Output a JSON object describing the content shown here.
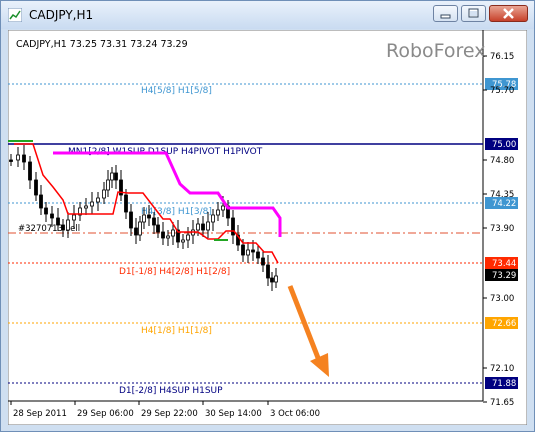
{
  "window": {
    "title": "CADJPY,H1"
  },
  "header": {
    "symbol_info": "CADJPY,H1  73.25 73.31 73.24 73.29",
    "watermark": "RoboForex"
  },
  "levels": [
    {
      "label": "H4[5/8] H1[5/8]",
      "price_tag": "75.78",
      "color": "#3f96d1"
    },
    {
      "label": "MN1[2/8] W1SUP D1SUP H4PIVOT H1PIVOT",
      "price_tag": "75.00",
      "color": "#000080"
    },
    {
      "label": "H4[3/8] H1[3/8]",
      "price_tag": "74.22",
      "color": "#3f96d1"
    },
    {
      "label": "",
      "price_tag": "",
      "color": "#e05030"
    },
    {
      "label": "D1[-1/8] H4[2/8] H1[2/8]",
      "price_tag": "73.44",
      "color": "#ff2a00"
    },
    {
      "label": "H4[1/8] H1[1/8]",
      "price_tag": "72.66",
      "color": "#ffa500"
    },
    {
      "label": "D1[-2/8] H4SUP H1SUP",
      "price_tag": "71.88",
      "color": "#000080"
    }
  ],
  "current_price": "73.29",
  "order_label": "#3270713 sell",
  "price_axis": [
    "76.15",
    "75.70",
    "74.80",
    "74.35",
    "73.90",
    "73.00",
    "72.10",
    "71.65"
  ],
  "time_axis": [
    "28 Sep 2011",
    "29 Sep 06:00",
    "29 Sep 22:00",
    "30 Sep 14:00",
    "3 Oct 06:00"
  ],
  "colors": {
    "red_line": "#ff0000",
    "magenta_line": "#ff00ff",
    "arrow": "#f58220",
    "candles": "#000000"
  }
}
